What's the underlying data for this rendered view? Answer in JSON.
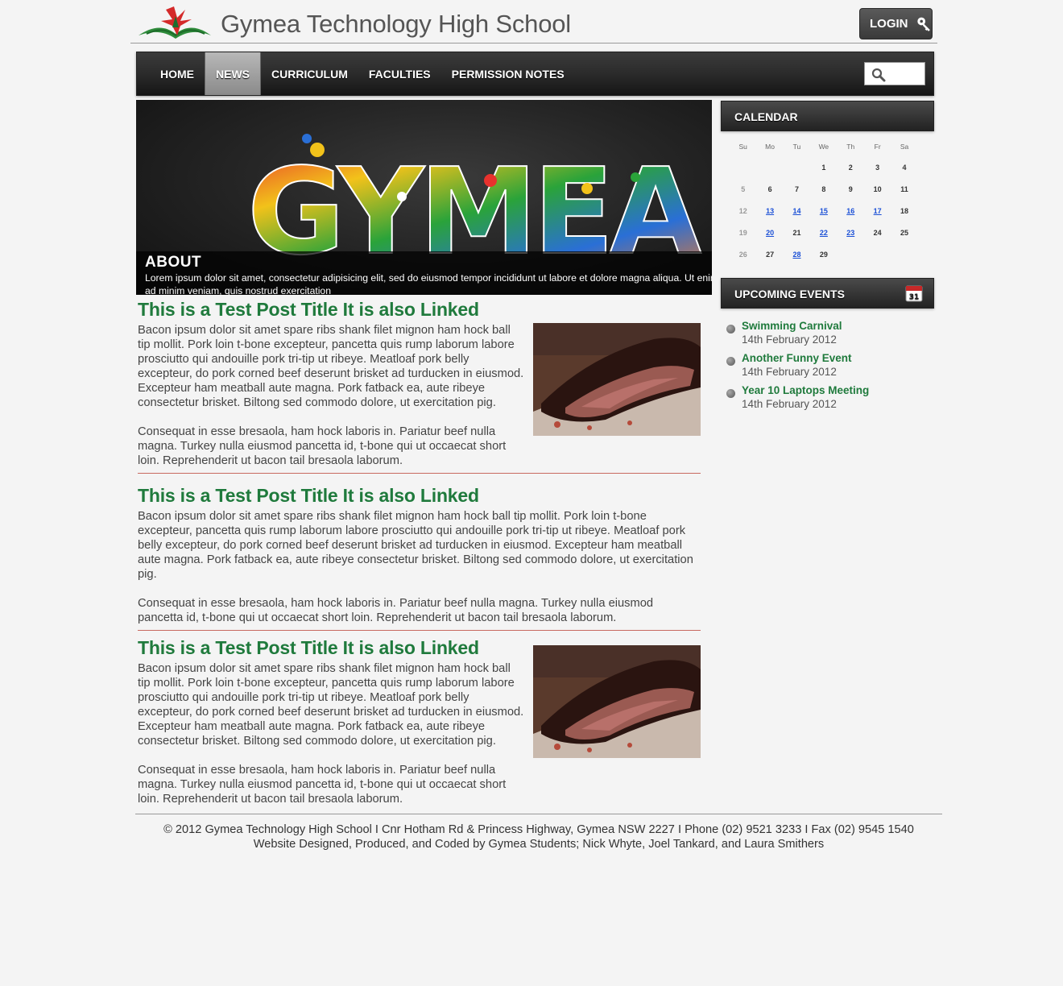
{
  "header": {
    "site_title": "Gymea Technology High School",
    "login_label": "LOGIN"
  },
  "nav": {
    "items": [
      {
        "label": "HOME",
        "active": false
      },
      {
        "label": "NEWS",
        "active": true
      },
      {
        "label": "CURRICULUM",
        "active": false
      },
      {
        "label": "FACULTIES",
        "active": false
      },
      {
        "label": "PERMISSION NOTES",
        "active": false
      }
    ],
    "search_value": ""
  },
  "banner": {
    "art_text": "GYMEA",
    "caption_title": "ABOUT",
    "caption_text": "Lorem ipsum dolor sit amet, consectetur adipisicing elit, sed do eiusmod tempor incididunt ut labore et dolore magna aliqua. Ut enim ad minim veniam, quis nostrud exercitation"
  },
  "posts": [
    {
      "title": "This is a Test Post Title It is also Linked",
      "para1": "Bacon ipsum dolor sit amet spare ribs shank filet mignon ham hock ball tip mollit. Pork loin t-bone excepteur, pancetta quis rump laborum labore prosciutto qui andouille pork tri-tip ut ribeye. Meatloaf pork belly excepteur, do pork corned beef deserunt brisket ad turducken in eiusmod. Excepteur ham meatball aute magna. Pork fatback ea, aute ribeye consectetur brisket. Biltong sed commodo dolore, ut exercitation pig.",
      "para2": "Consequat in esse bresaola, ham hock laboris in. Pariatur beef nulla magna. Turkey nulla eiusmod pancetta id, t-bone qui ut occaecat short loin. Reprehenderit ut bacon tail bresaola laborum."
    },
    {
      "title": "This is a Test Post Title It is also Linked",
      "para1": "Bacon ipsum dolor sit amet spare ribs shank filet mignon ham hock ball tip mollit. Pork loin t-bone excepteur, pancetta quis rump laborum labore prosciutto qui andouille pork tri-tip ut ribeye. Meatloaf pork belly excepteur, do pork corned beef deserunt brisket ad turducken in eiusmod. Excepteur ham meatball aute magna. Pork fatback ea, aute ribeye consectetur brisket. Biltong sed commodo dolore, ut exercitation pig.",
      "para2": "Consequat in esse bresaola, ham hock laboris in. Pariatur beef nulla magna. Turkey nulla eiusmod pancetta id, t-bone qui ut occaecat short loin. Reprehenderit ut bacon tail bresaola laborum."
    },
    {
      "title": "This is a Test Post Title It is also Linked",
      "para1": "Bacon ipsum dolor sit amet spare ribs shank filet mignon ham hock ball tip mollit. Pork loin t-bone excepteur, pancetta quis rump laborum labore prosciutto qui andouille pork tri-tip ut ribeye. Meatloaf pork belly excepteur, do pork corned beef deserunt brisket ad turducken in eiusmod. Excepteur ham meatball aute magna. Pork fatback ea, aute ribeye consectetur brisket. Biltong sed commodo dolore, ut exercitation pig.",
      "para2": "Consequat in esse bresaola, ham hock laboris in. Pariatur beef nulla magna. Turkey nulla eiusmod pancetta id, t-bone qui ut occaecat short loin. Reprehenderit ut bacon tail bresaola laborum."
    }
  ],
  "calendar": {
    "heading": "CALENDAR",
    "weekdays": [
      "Su",
      "Mo",
      "Tu",
      "We",
      "Th",
      "Fr",
      "Sa"
    ],
    "weeks": [
      [
        "",
        "",
        "",
        "1",
        "2",
        "3",
        "4"
      ],
      [
        "5",
        "6",
        "7",
        "8",
        "9",
        "10",
        "11"
      ],
      [
        "12",
        "13",
        "14",
        "15",
        "16",
        "17",
        "18"
      ],
      [
        "19",
        "20",
        "21",
        "22",
        "23",
        "24",
        "25"
      ],
      [
        "26",
        "27",
        "28",
        "29",
        "",
        "",
        ""
      ]
    ],
    "linked_days": [
      "13",
      "14",
      "15",
      "16",
      "17",
      "20",
      "22",
      "23",
      "28"
    ]
  },
  "events": {
    "heading": "UPCOMING EVENTS",
    "calendar_icon_day": "31",
    "items": [
      {
        "title": "Swimming Carnival",
        "date": "14th February 2012"
      },
      {
        "title": "Another Funny Event",
        "date": "14th February 2012"
      },
      {
        "title": "Year 10 Laptops Meeting",
        "date": "14th February 2012"
      }
    ]
  },
  "footer": {
    "line1": "© 2012 Gymea Technology High School I Cnr Hotham Rd & Princess Highway, Gymea NSW 2227 I Phone (02) 9521 3233 I Fax (02) 9545 1540",
    "line2": "Website Designed, Produced, and Coded by Gymea Students; Nick Whyte, Joel Tankard, and Laura Smithers"
  },
  "colors": {
    "accent_green": "#1f7a3c",
    "divider_red": "#c8695f",
    "calendar_link": "#1a4fd6"
  }
}
